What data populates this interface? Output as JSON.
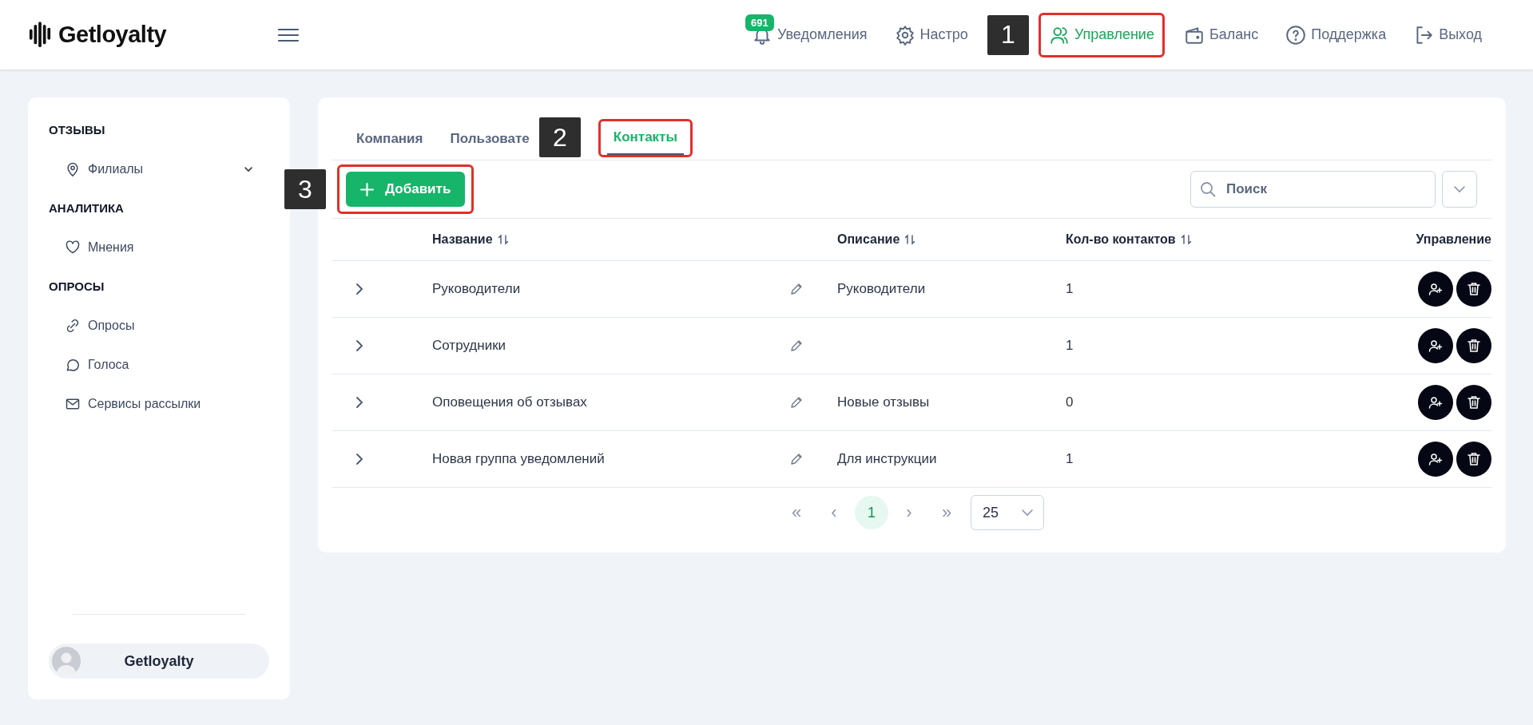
{
  "header": {
    "logo": "Getloyalty",
    "nav": [
      {
        "kind": "bell",
        "label": "Уведомления",
        "badge": "691",
        "selected": false
      },
      {
        "kind": "gear",
        "label": "Настро",
        "selected": false
      },
      {
        "kind": "users",
        "label": "Управление",
        "selected": true,
        "callout": "1"
      },
      {
        "kind": "wallet",
        "label": "Баланс",
        "selected": false
      },
      {
        "kind": "help",
        "label": "Поддержка",
        "selected": false
      },
      {
        "kind": "logout",
        "label": "Выход",
        "selected": false
      }
    ]
  },
  "sidebar": {
    "sections": [
      {
        "title": "ОТЗЫВЫ",
        "items": [
          {
            "kind": "pin",
            "label": "Филиалы",
            "expandable": true
          }
        ]
      },
      {
        "title": "АНАЛИТИКА",
        "items": [
          {
            "kind": "heart",
            "label": "Мнения",
            "expandable": false
          }
        ]
      },
      {
        "title": "ОПРОСЫ",
        "items": [
          {
            "kind": "link",
            "label": "Опросы",
            "expandable": false
          },
          {
            "kind": "chat",
            "label": "Голоса",
            "expandable": false
          },
          {
            "kind": "mail",
            "label": "Сервисы рассылки",
            "expandable": false
          }
        ]
      }
    ],
    "user": {
      "name": "Getloyalty"
    }
  },
  "tabs": [
    {
      "label": "Компания",
      "selected": false
    },
    {
      "label": "Пользовате",
      "selected": false
    },
    {
      "label": "Контакты",
      "selected": true,
      "callout": "2"
    }
  ],
  "toolbar": {
    "add_button": {
      "label": "Добавить",
      "callout": "3"
    },
    "search": {
      "placeholder": "Поиск"
    }
  },
  "table": {
    "columns": [
      {
        "label": "Название",
        "sortable": true
      },
      {
        "label": "Описание",
        "sortable": true
      },
      {
        "label": "Кол-во контактов",
        "sortable": true
      },
      {
        "label": "Управление",
        "sortable": false
      }
    ],
    "rows": [
      {
        "name": "Руководители",
        "description": "Руководители",
        "count": "1",
        "expanded": false
      },
      {
        "name": "Сотрудники",
        "count": "1",
        "expanded": false
      },
      {
        "name": "Оповещения об отзывах",
        "description": "Новые отзывы",
        "count": "0",
        "expanded": false
      },
      {
        "name": "Новая группа уведомлений",
        "description": "Для инструкции",
        "count": "1",
        "expanded": false
      }
    ]
  },
  "pagination": {
    "first": "«",
    "prev": "‹",
    "pages": [
      {
        "label": "1",
        "selected": true
      }
    ],
    "next": "›",
    "last": "»",
    "page_size": "25"
  }
}
